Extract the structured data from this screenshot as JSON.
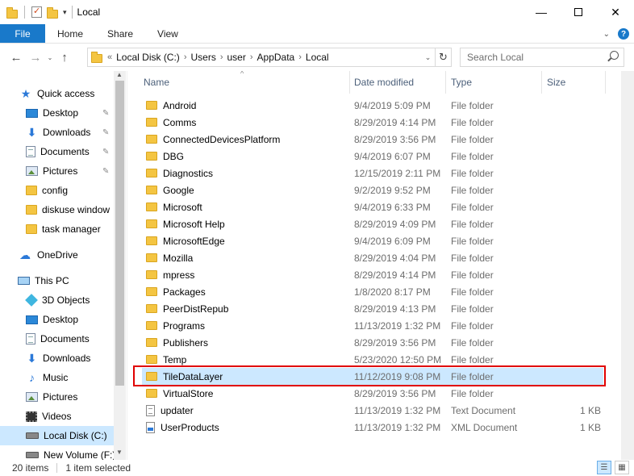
{
  "window": {
    "title": "Local",
    "minimize": "—",
    "close": "✕"
  },
  "ribbon": {
    "tabs": [
      "File",
      "Home",
      "Share",
      "View"
    ],
    "expand": "⌄",
    "help": "?"
  },
  "nav": {
    "back": "←",
    "forward": "→",
    "recent": "⌄",
    "up": "↑",
    "path_prefix": "«",
    "breadcrumb": [
      "Local Disk (C:)",
      "Users",
      "user",
      "AppData",
      "Local"
    ],
    "chevron": "›",
    "refresh": "↻",
    "search_placeholder": "Search Local"
  },
  "navpane": {
    "items": [
      {
        "label": "Quick access",
        "icon": "star-icon",
        "pinned": false
      },
      {
        "label": "Desktop",
        "icon": "desktop-icon",
        "pinned": true
      },
      {
        "label": "Downloads",
        "icon": "download-icon",
        "pinned": true
      },
      {
        "label": "Documents",
        "icon": "documents-icon",
        "pinned": true
      },
      {
        "label": "Pictures",
        "icon": "pictures-icon",
        "pinned": true
      },
      {
        "label": "config",
        "icon": "folder-icon",
        "pinned": false
      },
      {
        "label": "diskuse window",
        "icon": "folder-icon",
        "pinned": false
      },
      {
        "label": "task manager",
        "icon": "folder-icon",
        "pinned": false
      },
      {
        "label": "OneDrive",
        "icon": "cloud-icon",
        "pinned": false
      },
      {
        "label": "This PC",
        "icon": "computer-icon",
        "pinned": false
      },
      {
        "label": "3D Objects",
        "icon": "3d-objects-icon",
        "pinned": false
      },
      {
        "label": "Desktop",
        "icon": "desktop-icon",
        "pinned": false
      },
      {
        "label": "Documents",
        "icon": "documents-icon",
        "pinned": false
      },
      {
        "label": "Downloads",
        "icon": "download-icon",
        "pinned": false
      },
      {
        "label": "Music",
        "icon": "music-icon",
        "pinned": false
      },
      {
        "label": "Pictures",
        "icon": "pictures-icon",
        "pinned": false
      },
      {
        "label": "Videos",
        "icon": "videos-icon",
        "pinned": false
      },
      {
        "label": "Local Disk (C:)",
        "icon": "drive-icon",
        "pinned": false,
        "selected": true
      },
      {
        "label": "New Volume (F:)",
        "icon": "drive-icon",
        "pinned": false
      }
    ],
    "pin_glyph": "📌",
    "scroll_up": "▲",
    "scroll_down": "▼"
  },
  "columns": {
    "name": "Name",
    "date": "Date modified",
    "type": "Type",
    "size": "Size",
    "sort_glyph": "^"
  },
  "files": [
    {
      "name": "Android",
      "date": "9/4/2019 5:09 PM",
      "type": "File folder",
      "size": "",
      "kind": "folder"
    },
    {
      "name": "Comms",
      "date": "8/29/2019 4:14 PM",
      "type": "File folder",
      "size": "",
      "kind": "folder"
    },
    {
      "name": "ConnectedDevicesPlatform",
      "date": "8/29/2019 3:56 PM",
      "type": "File folder",
      "size": "",
      "kind": "folder"
    },
    {
      "name": "DBG",
      "date": "9/4/2019 6:07 PM",
      "type": "File folder",
      "size": "",
      "kind": "folder"
    },
    {
      "name": "Diagnostics",
      "date": "12/15/2019 2:11 PM",
      "type": "File folder",
      "size": "",
      "kind": "folder"
    },
    {
      "name": "Google",
      "date": "9/2/2019 9:52 PM",
      "type": "File folder",
      "size": "",
      "kind": "folder"
    },
    {
      "name": "Microsoft",
      "date": "9/4/2019 6:33 PM",
      "type": "File folder",
      "size": "",
      "kind": "folder"
    },
    {
      "name": "Microsoft Help",
      "date": "8/29/2019 4:09 PM",
      "type": "File folder",
      "size": "",
      "kind": "folder"
    },
    {
      "name": "MicrosoftEdge",
      "date": "9/4/2019 6:09 PM",
      "type": "File folder",
      "size": "",
      "kind": "folder"
    },
    {
      "name": "Mozilla",
      "date": "8/29/2019 4:04 PM",
      "type": "File folder",
      "size": "",
      "kind": "folder"
    },
    {
      "name": "mpress",
      "date": "8/29/2019 4:14 PM",
      "type": "File folder",
      "size": "",
      "kind": "folder"
    },
    {
      "name": "Packages",
      "date": "1/8/2020 8:17 PM",
      "type": "File folder",
      "size": "",
      "kind": "folder"
    },
    {
      "name": "PeerDistRepub",
      "date": "8/29/2019 4:13 PM",
      "type": "File folder",
      "size": "",
      "kind": "folder"
    },
    {
      "name": "Programs",
      "date": "11/13/2019 1:32 PM",
      "type": "File folder",
      "size": "",
      "kind": "folder"
    },
    {
      "name": "Publishers",
      "date": "8/29/2019 3:56 PM",
      "type": "File folder",
      "size": "",
      "kind": "folder"
    },
    {
      "name": "Temp",
      "date": "5/23/2020 12:50 PM",
      "type": "File folder",
      "size": "",
      "kind": "folder"
    },
    {
      "name": "TileDataLayer",
      "date": "11/12/2019 9:08 PM",
      "type": "File folder",
      "size": "",
      "kind": "folder",
      "selected": true
    },
    {
      "name": "VirtualStore",
      "date": "8/29/2019 3:56 PM",
      "type": "File folder",
      "size": "",
      "kind": "folder"
    },
    {
      "name": "updater",
      "date": "11/13/2019 1:32 PM",
      "type": "Text Document",
      "size": "1 KB",
      "kind": "text"
    },
    {
      "name": "UserProducts",
      "date": "11/13/2019 1:32 PM",
      "type": "XML Document",
      "size": "1 KB",
      "kind": "xml"
    }
  ],
  "status": {
    "count": "20 items",
    "selection": "1 item selected"
  },
  "colors": {
    "accent": "#1979ca",
    "selection": "#cce8ff",
    "highlight": "#e00000",
    "folder": "#f4c542"
  }
}
